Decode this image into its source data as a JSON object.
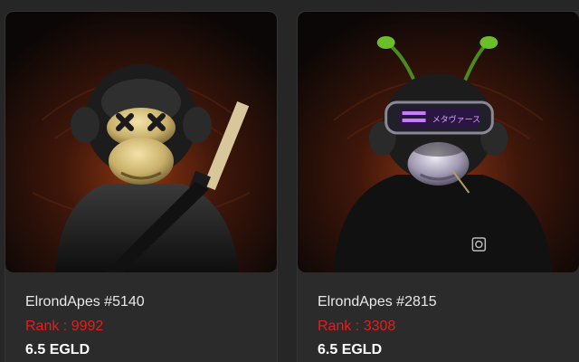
{
  "nfts": [
    {
      "name": "ElrondApes #5140",
      "rank": "Rank : 9992",
      "price": "6.5 EGLD"
    },
    {
      "name": "ElrondApes #2815",
      "rank": "Rank : 3308",
      "price": "6.5 EGLD",
      "visor_text": "メタヴァース"
    }
  ],
  "colors": {
    "background": "#262626",
    "card": "#2b2b2b",
    "rank": "#e41e1e",
    "price": "#ffffff",
    "name": "#e8e8e8",
    "art_glow": "#7a2a0c",
    "visor": "#b05cff",
    "antenna": "#5fa02a"
  }
}
